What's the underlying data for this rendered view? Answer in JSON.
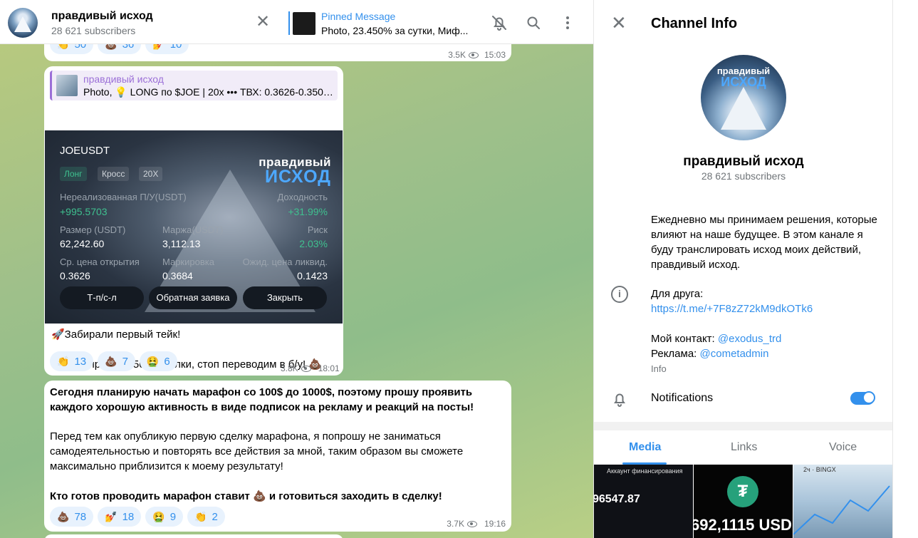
{
  "header": {
    "title": "правдивый исход",
    "subscribers": "28 621 subscribers",
    "pinned_label": "Pinned Message",
    "pinned_text": "Photo, 23.450% за сутки, Миф..."
  },
  "messages": {
    "top": {
      "reactions": [
        {
          "emoji": "👏",
          "count": "50"
        },
        {
          "emoji": "💩",
          "count": "36"
        },
        {
          "emoji": "💅",
          "count": "10"
        }
      ],
      "views": "3.5K",
      "time": "15:03"
    },
    "photo": {
      "reply_name": "правдивый исход",
      "reply_text": "Photo, 💡 LONG по $JOE | 20x ••• ТВХ: 0.3626-0.3504 ...",
      "card": {
        "pair": "JOEUSDT",
        "tag_long": "Лонг",
        "tag_cross": "Кросс",
        "tag_lev": "20X",
        "logo_line1": "правдивый",
        "logo_line2": "ИСХОД",
        "unrealized_label": "Нереализованная П/У(USDT)",
        "unrealized_value": "+995.5703",
        "yield_label": "Доходность",
        "yield_value": "+31.99%",
        "size_label": "Размер (USDT)",
        "size_value": "62,242.60",
        "margin_label": "Маржа(USDT)",
        "margin_value": "3,112.13",
        "risk_label": "Риск",
        "risk_value": "2.03%",
        "entry_label": "Ср. цена открытия",
        "entry_value": "0.3626",
        "mark_label": "Маркировка",
        "mark_value": "0.3684",
        "liq_label": "Ожид. цена ликвид.",
        "liq_value": "0.1423",
        "btn_tpsl": "Т-п/с-л",
        "btn_reverse": "Обратная заявка",
        "btn_close": "Закрыть"
      },
      "text_line1": "🚀Забирали первый тейк!",
      "text_line2": "Зафиксировали 50% сделки, стоп переводим в б/у! 💩",
      "reactions": [
        {
          "emoji": "👏",
          "count": "13"
        },
        {
          "emoji": "💩",
          "count": "7"
        },
        {
          "emoji": "🤮",
          "count": "6"
        }
      ],
      "views": "3.8K",
      "time": "18:01"
    },
    "marathon": {
      "p1": "Сегодня планирую начать марафон со 100$ до 1000$, поэтому прошу проявить каждого хорошую активность в виде подписок на рекламу и реакций на посты!",
      "p2": "Перед тем как опубликую первую сделку марафона, я попрошу не заниматься самодеятельностью и повторять все действия за мной, таким образом вы сможете максимально приблизится к моему результату!",
      "p3": "Кто готов проводить марафон ставит 💩 и готовиться заходить в сделку!",
      "reactions": [
        {
          "emoji": "💩",
          "count": "78"
        },
        {
          "emoji": "💅",
          "count": "18"
        },
        {
          "emoji": "🤮",
          "count": "9"
        },
        {
          "emoji": "👏",
          "count": "2"
        }
      ],
      "views": "3.7K",
      "time": "19:16"
    }
  },
  "info": {
    "title": "Channel Info",
    "avatar_line1": "правдивый",
    "avatar_line2": "ИСХОД",
    "name": "правдивый исход",
    "subscribers": "28 621 subscribers",
    "description": "Ежедневно мы принимаем решения, которые влияют на наше будущее. В этом канале я буду транслировать исход моих действий, правдивый исход.",
    "friend_label": "Для друга:",
    "friend_link": "https://t.me/+7F8zZ72kM9dkOTk6",
    "contact_label": "Мой контакт:",
    "contact_handle": "@exodus_trd",
    "ads_label": "Реклама:",
    "ads_handle": "@cometadmin",
    "info_caption": "Info",
    "notifications_label": "Notifications",
    "notifications_on": true,
    "tabs": [
      "Media",
      "Links",
      "Voice"
    ],
    "media": {
      "m1_title": "Аккаунт финансирования",
      "m1_value": "96547.87",
      "m2_value": "692,1115 USD",
      "m3_title": "2ч · BINGX"
    }
  },
  "colors": {
    "accent": "#3390ec",
    "reply_accent": "#9b6fd7",
    "positive": "#3fc08f"
  },
  "icons": [
    "close-icon",
    "bell-off-icon",
    "search-icon",
    "more-vert-icon",
    "eye-icon",
    "info-icon",
    "bell-icon"
  ]
}
